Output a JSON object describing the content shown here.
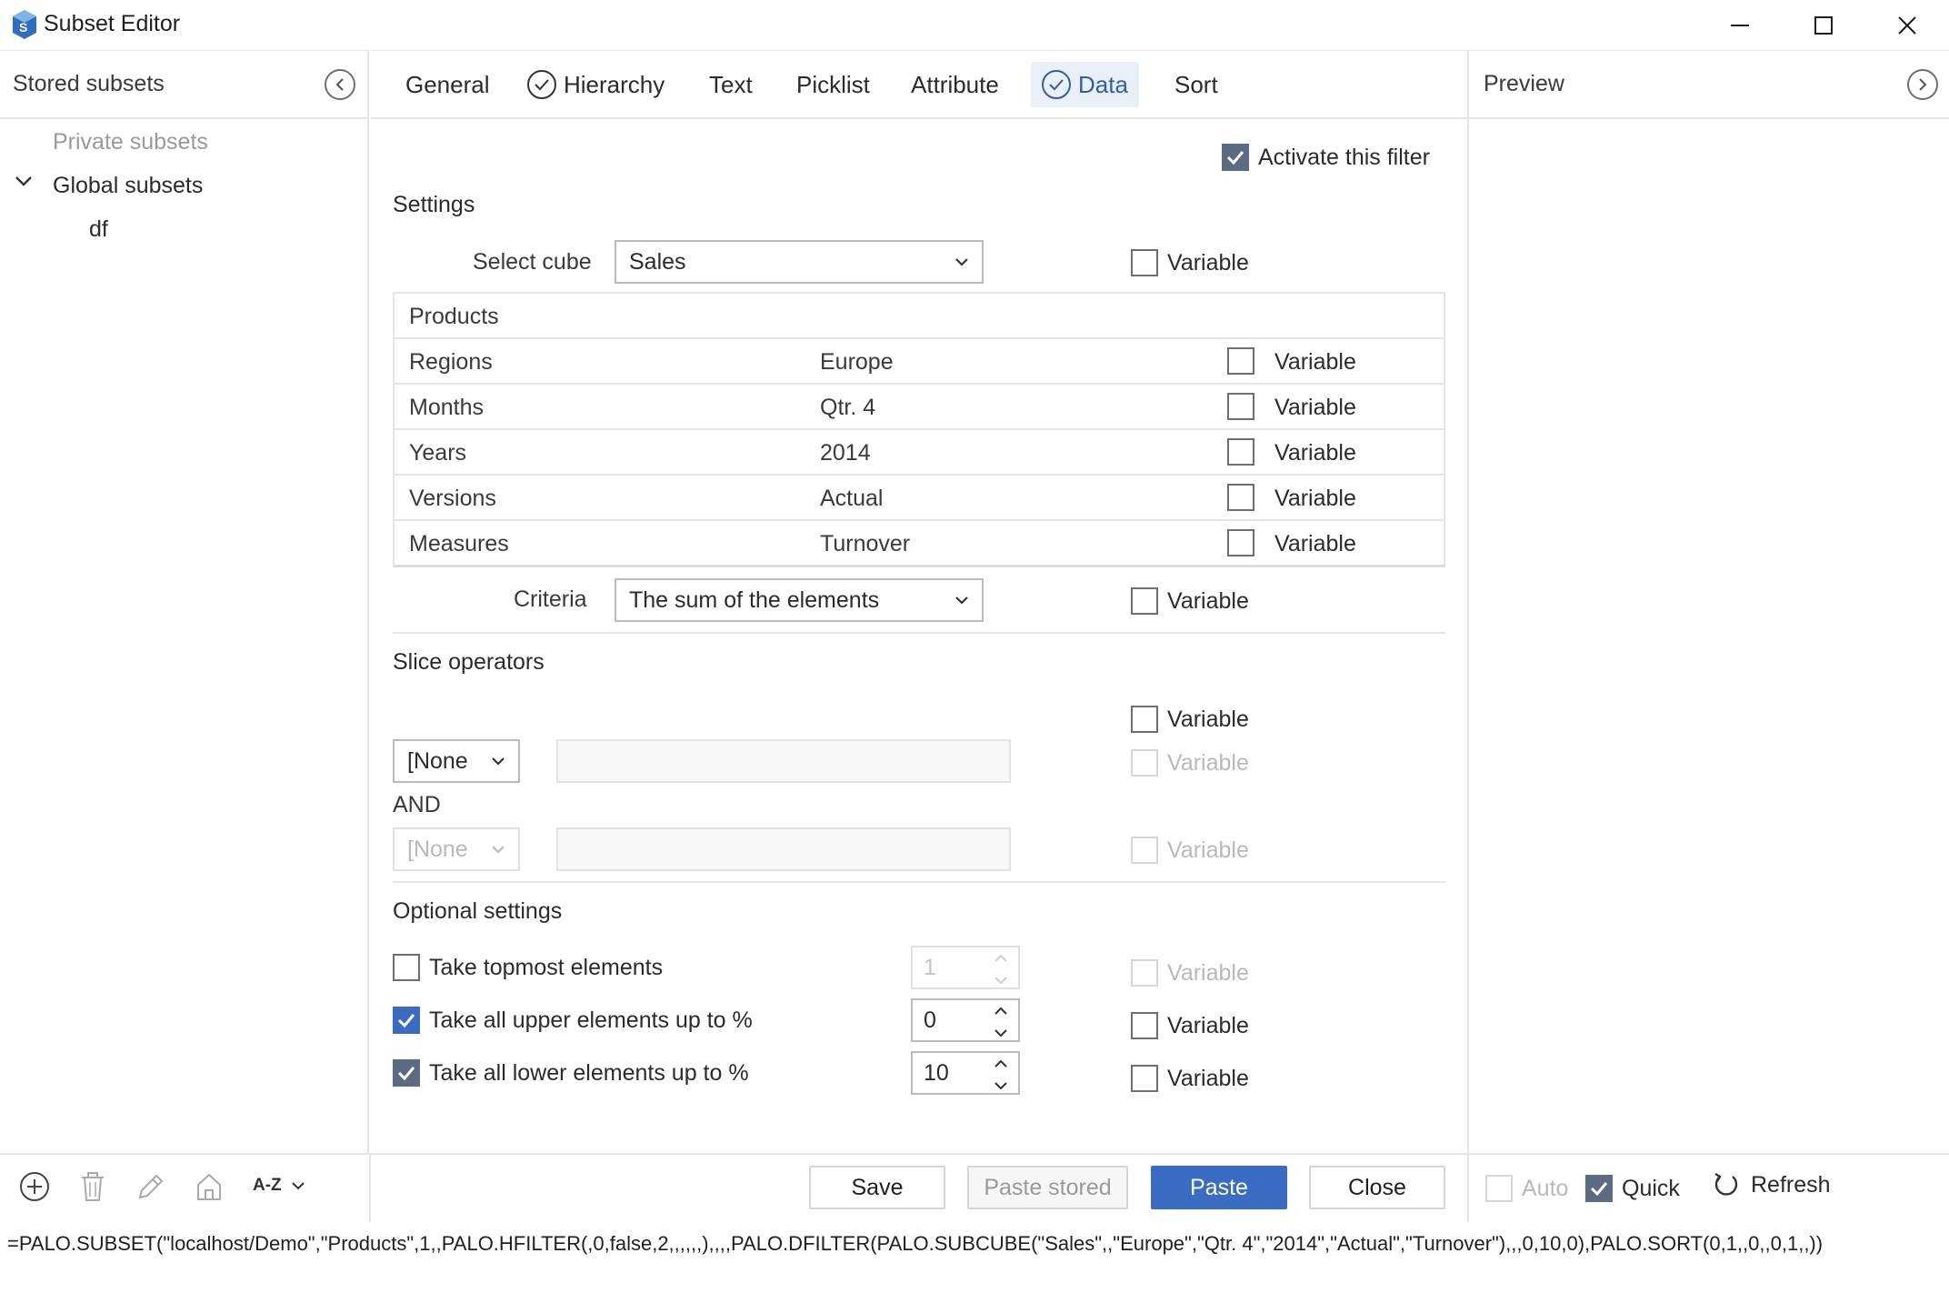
{
  "window": {
    "title": "Subset Editor"
  },
  "left": {
    "title": "Stored subsets",
    "tree": {
      "private": "Private subsets",
      "global": "Global subsets",
      "child": "df"
    },
    "sort_label": "A-Z"
  },
  "tabs": [
    {
      "label": "General"
    },
    {
      "label": "Hierarchy"
    },
    {
      "label": "Text"
    },
    {
      "label": "Picklist"
    },
    {
      "label": "Attribute"
    },
    {
      "label": "Data"
    },
    {
      "label": "Sort"
    }
  ],
  "preview": {
    "title": "Preview"
  },
  "main": {
    "activate_label": "Activate this filter",
    "settings_title": "Settings",
    "select_cube_label": "Select cube",
    "cube_value": "Sales",
    "variable_label": "Variable",
    "dimensions": [
      {
        "name": "Products",
        "value": ""
      },
      {
        "name": "Regions",
        "value": "Europe"
      },
      {
        "name": "Months",
        "value": "Qtr. 4"
      },
      {
        "name": "Years",
        "value": "2014"
      },
      {
        "name": "Versions",
        "value": "Actual"
      },
      {
        "name": "Measures",
        "value": "Turnover"
      }
    ],
    "criteria_label": "Criteria",
    "criteria_value": "The sum of the elements",
    "slice_title": "Slice operators",
    "operator1": "[None",
    "and_label": "AND",
    "operator2": "[None",
    "optional_title": "Optional settings",
    "topmost_label": "Take topmost elements",
    "topmost_value": "1",
    "upper_label": "Take all upper elements up to %",
    "upper_value": "0",
    "lower_label": "Take all lower elements up to %",
    "lower_value": "10"
  },
  "footer": {
    "save": "Save",
    "paste_stored": "Paste stored",
    "paste": "Paste",
    "close": "Close",
    "auto": "Auto",
    "quick": "Quick",
    "refresh": "Refresh"
  },
  "formula": "=PALO.SUBSET(\"localhost/Demo\",\"Products\",1,,PALO.HFILTER(,0,false,2,,,,,,),,,,PALO.DFILTER(PALO.SUBCUBE(\"Sales\",,\"Europe\",\"Qtr. 4\",\"2014\",\"Actual\",\"Turnover\"),,,0,10,0),PALO.SORT(0,1,,0,,0,1,,))",
  "colors": {
    "accent": "#3a6cc4",
    "checked": "#5b6b82",
    "active_tab_bg": "#eaf0f8"
  }
}
